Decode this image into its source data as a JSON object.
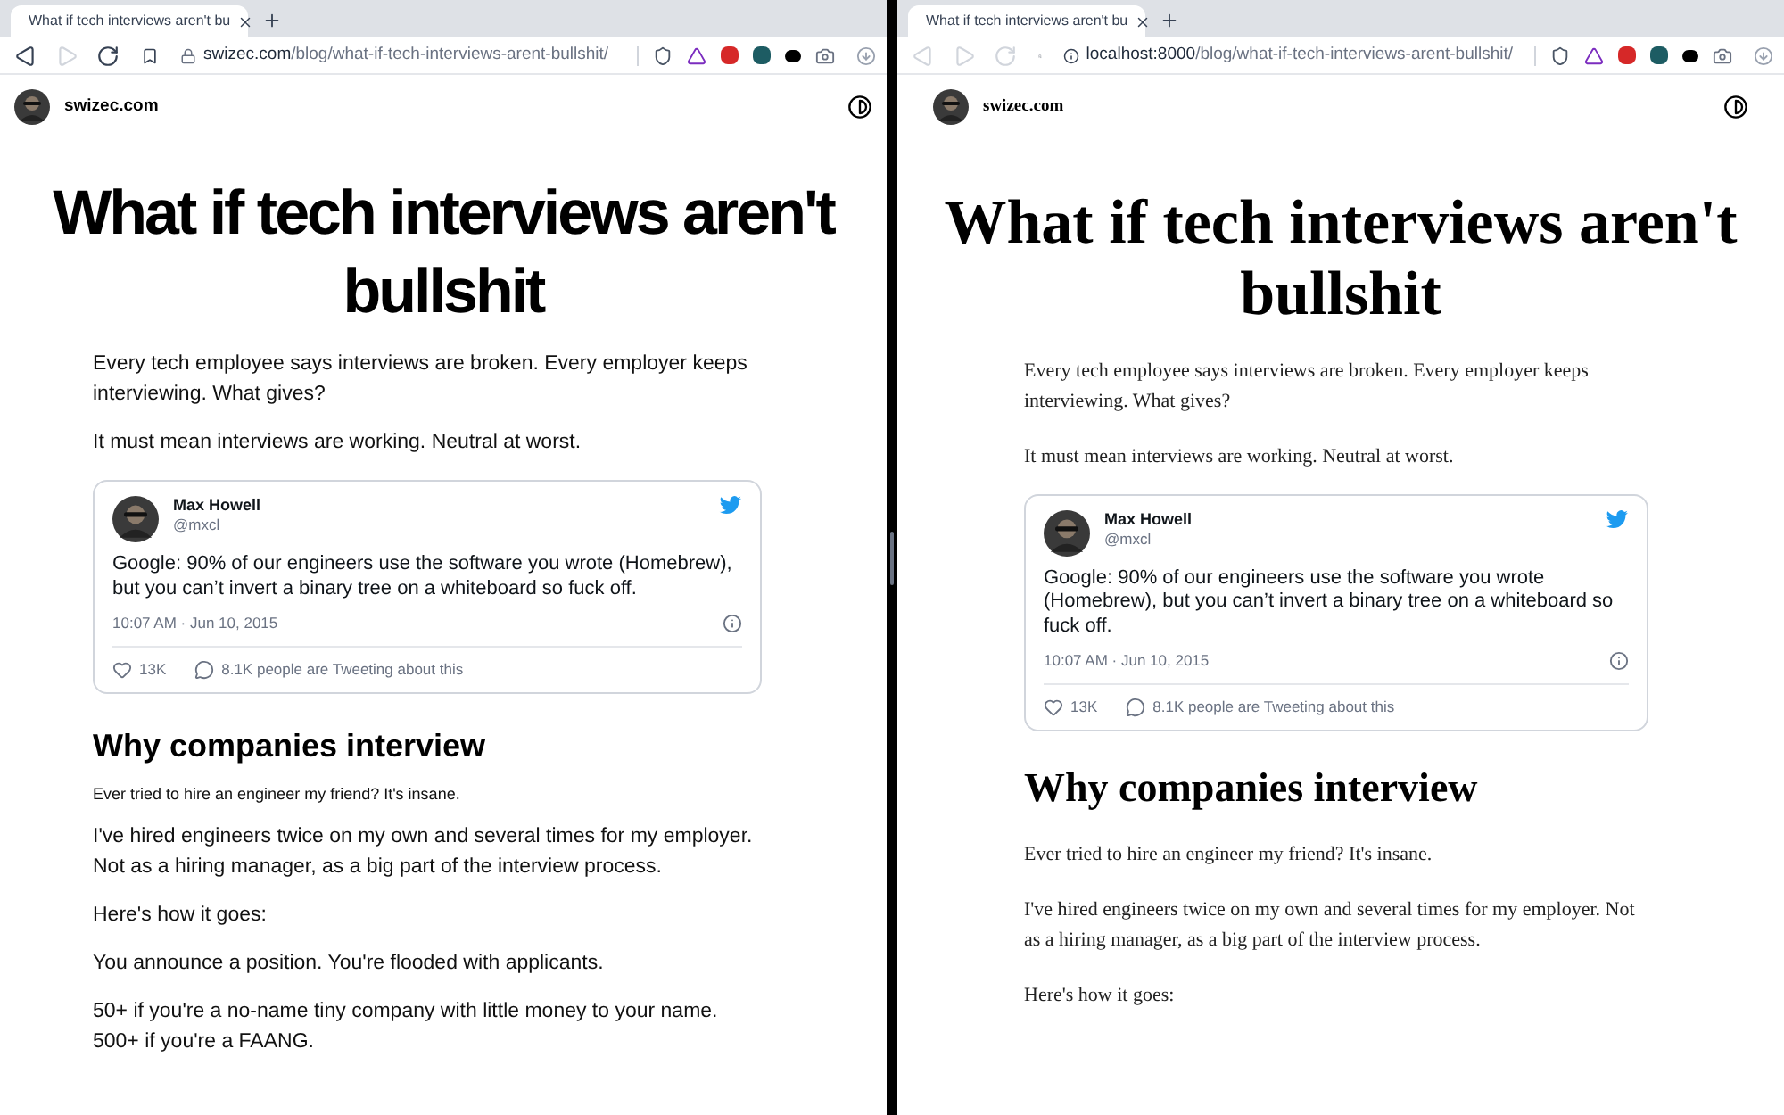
{
  "windows": [
    {
      "tab": {
        "title": "What if tech interviews aren't bu"
      },
      "nav": [
        {
          "kind": "back",
          "disabled": false
        },
        {
          "kind": "forward",
          "disabled": true
        },
        {
          "kind": "reload",
          "disabled": false
        }
      ],
      "address": {
        "kind": "lock",
        "host": "swizec.com",
        "path": "/blog/what-if-tech-interviews-arent-bullshit/"
      },
      "site": {
        "name": "swizec.com"
      },
      "article": {
        "title": "What if tech interviews aren't bullshit",
        "blocks": [
          {
            "kind": "paragraph",
            "text": "Every tech employee says interviews are broken. Every employer keeps interviewing. What gives?"
          },
          {
            "kind": "paragraph",
            "text": "It must mean interviews are working. Neutral at worst."
          },
          {
            "kind": "tweet",
            "author": "Max Howell",
            "handle": "@mxcl",
            "text": "Google: 90% of our engineers use the software you wrote (Homebrew), but you can’t invert a binary tree on a whiteboard so fuck off.",
            "time": "10:07 AM · Jun 10, 2015",
            "likes": "13K",
            "replies": "8.1K people are Tweeting about this"
          },
          {
            "kind": "heading",
            "text": "Why companies interview"
          },
          {
            "kind": "small",
            "text": "Ever tried to hire an engineer my friend? It's insane."
          },
          {
            "kind": "paragraph",
            "text": "I've hired engineers twice on my own and several times for my employer. Not as a hiring manager, as a big part of the interview process."
          },
          {
            "kind": "paragraph",
            "text": "Here's how it goes:"
          },
          {
            "kind": "paragraph",
            "text": "You announce a position. You're flooded with applicants."
          },
          {
            "kind": "paragraph",
            "text": "50+ if you're a no-name tiny company with little money to your name. 500+ if you're a FAANG."
          }
        ]
      }
    },
    {
      "tab": {
        "title": "What if tech interviews aren't bu"
      },
      "nav": [
        {
          "kind": "back",
          "disabled": true
        },
        {
          "kind": "forward",
          "disabled": true
        },
        {
          "kind": "reload",
          "disabled": true
        }
      ],
      "address": {
        "kind": "info",
        "host": "localhost:8000",
        "path": "/blog/what-if-tech-interviews-arent-bullshit/"
      },
      "site": {
        "name": "swizec.com"
      },
      "article": {
        "title": "What if tech interviews aren't bullshit",
        "blocks": [
          {
            "kind": "paragraph",
            "text": "Every tech employee says interviews are broken. Every employer keeps interviewing. What gives?"
          },
          {
            "kind": "paragraph",
            "text": "It must mean interviews are working. Neutral at worst."
          },
          {
            "kind": "tweet",
            "author": "Max Howell",
            "handle": "@mxcl",
            "text": "Google: 90% of our engineers use the software you wrote (Homebrew), but you can’t invert a binary tree on a whiteboard so fuck off.",
            "time": "10:07 AM · Jun 10, 2015",
            "likes": "13K",
            "replies": "8.1K people are Tweeting about this"
          },
          {
            "kind": "heading",
            "text": "Why companies interview"
          },
          {
            "kind": "paragraph",
            "text": "Ever tried to hire an engineer my friend? It's insane."
          },
          {
            "kind": "paragraph",
            "text": "I've hired engineers twice on my own and several times for my employer. Not as a hiring manager, as a big part of the interview process."
          },
          {
            "kind": "paragraph",
            "text": "Here's how it goes:"
          }
        ]
      }
    }
  ]
}
